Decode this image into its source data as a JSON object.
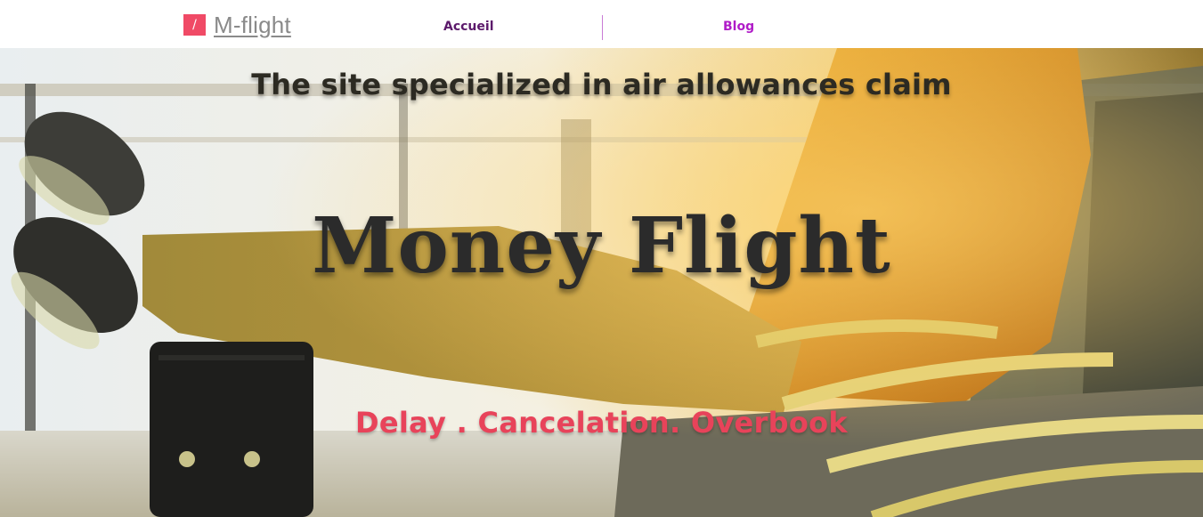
{
  "header": {
    "logo_mark": "/",
    "logo_text": "M-flight",
    "nav": {
      "accueil": "Accueil",
      "blog": "Blog"
    }
  },
  "hero": {
    "tagline": "The site specialized in air allowances claim",
    "title": "Money Flight",
    "subtitle": "Delay . Cancelation. Overbook"
  },
  "colors": {
    "accent": "#f04a66",
    "nav_active": "#5c1a6b",
    "nav_link": "#b01cc8",
    "subtitle": "#e8435a"
  }
}
